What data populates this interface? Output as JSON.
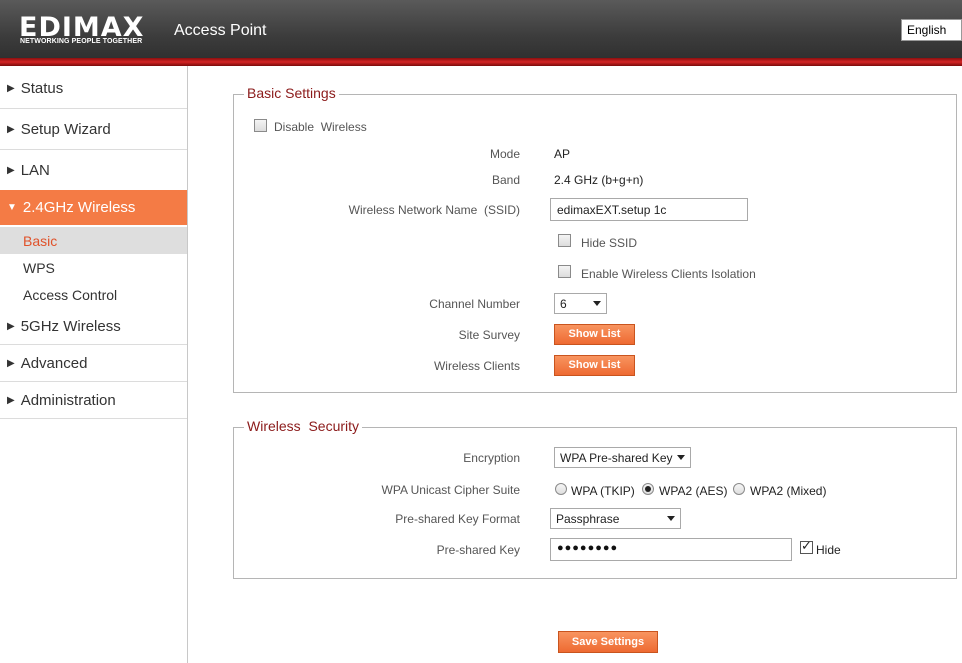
{
  "header": {
    "logo": "EDIMAX",
    "logo_tagline": "NETWORKING PEOPLE TOGETHER",
    "title": "Access Point",
    "language": "English"
  },
  "sidebar": {
    "items": [
      {
        "label": "Status"
      },
      {
        "label": "Setup Wizard"
      },
      {
        "label": "LAN"
      },
      {
        "label": "2.4GHz Wireless",
        "expanded": true
      },
      {
        "label": "5GHz Wireless"
      },
      {
        "label": "Advanced"
      },
      {
        "label": "Administration"
      }
    ],
    "subitems": [
      {
        "label": "Basic",
        "selected": true
      },
      {
        "label": "WPS"
      },
      {
        "label": "Access Control"
      }
    ],
    "arrow_collapsed": "▶",
    "arrow_expanded": "▼"
  },
  "basic": {
    "legend": "Basic Settings",
    "disable_wireless_label": "Disable  Wireless",
    "disable_wireless_checked": false,
    "mode_label": "Mode",
    "mode_value": "AP",
    "band_label": "Band",
    "band_value": "2.4 GHz (b+g+n)",
    "ssid_label": "Wireless Network Name  (SSID)",
    "ssid_value": "edimaxEXT.setup 1c",
    "hide_ssid_label": "Hide SSID",
    "hide_ssid_checked": false,
    "isolation_label": "Enable Wireless Clients Isolation",
    "isolation_checked": false,
    "channel_label": "Channel Number",
    "channel_value": "6",
    "site_survey_label": "Site Survey",
    "site_survey_button": "Show List",
    "clients_label": "Wireless Clients",
    "clients_button": "Show List"
  },
  "security": {
    "legend": "Wireless  Security",
    "encryption_label": "Encryption",
    "encryption_value": "WPA Pre-shared Key",
    "cipher_label": "WPA Unicast Cipher Suite",
    "cipher_options": [
      {
        "label": "WPA (TKIP)",
        "selected": false
      },
      {
        "label": "WPA2 (AES)",
        "selected": true
      },
      {
        "label": "WPA2 (Mixed)",
        "selected": false
      }
    ],
    "key_format_label": "Pre-shared Key Format",
    "key_format_value": "Passphrase",
    "key_label": "Pre-shared Key",
    "key_value": "●●●●●●●●",
    "hide_label": "Hide",
    "hide_checked": true
  },
  "save_button": "Save Settings",
  "colors": {
    "accent": "#f47b45",
    "legend": "#8b1a1a",
    "header_red": "#d42424"
  }
}
